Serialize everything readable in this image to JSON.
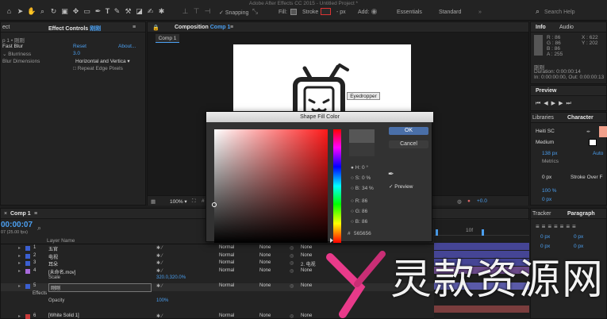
{
  "app_title": "Adobe After Effects CC 2015 - Untitled Project *",
  "toolbar": {
    "snapping": "Snapping",
    "fill": "Fill:",
    "stroke": "Stroke",
    "stroke_px": "- px",
    "add": "Add:",
    "workspaces": [
      "Essentials",
      "Standard"
    ],
    "search_placeholder": "Search Help"
  },
  "effect_controls": {
    "layer_left": "p 1 • 刚刚",
    "tab": "Effect Controls",
    "tab_layer": "刚刚",
    "fx_name": "Fast Blur",
    "reset": "Reset",
    "about": "About...",
    "blurriness_label": "Blurriness",
    "blurriness_value": "3.0",
    "blur_dimensions_label": "Blur Dimensions",
    "blur_dimensions_value": "Horizontal and Vertica",
    "repeat_edge": "Repeat Edge Pixels"
  },
  "composition": {
    "tab": "Composition",
    "tab_name": "Comp 1",
    "sub_tab": "Comp 1",
    "tooltip": "Eyedropper",
    "zoom": "100%",
    "timecode": "+0.0"
  },
  "info": {
    "tab": "Info",
    "tab2": "Audio",
    "r": "R : 86",
    "g": "G : 86",
    "b": "B : 86",
    "a": "A : 255",
    "x": "X : 622",
    "y": "Y : 202",
    "layer": "刚刚",
    "duration": "Duration: 0:00:00:14",
    "in_out": "In: 0:00:00:00, Out: 0:00:00:13"
  },
  "preview": {
    "tab": "Preview"
  },
  "libraries": {
    "tab": "Libraries"
  },
  "character": {
    "tab": "Character",
    "font": "Heiti SC",
    "style": "Medium",
    "size": "138 px",
    "auto": "Auto",
    "metrics": "Metrics",
    "indent": "0 px",
    "stroke_over": "Stroke Over F",
    "vscale": "100 %",
    "baseline": "0 px"
  },
  "tracker": {
    "tab": "Tracker",
    "tab2": "Paragraph"
  },
  "dialog": {
    "title": "Shape Fill Color",
    "ok": "OK",
    "cancel": "Cancel",
    "preview": "Preview",
    "h_label": "H:",
    "h_value": "0 °",
    "s_label": "S:",
    "s_value": "0 %",
    "b_label": "B:",
    "b_value": "34 %",
    "r_label": "R:",
    "r_value": "86",
    "g_label": "G:",
    "g_value": "86",
    "b2_label": "B:",
    "b2_value": "86",
    "hex_label": "#",
    "hex_value": "565656",
    "new_color": "#565656",
    "current_color": "#3a3a3a"
  },
  "timeline": {
    "tab": "Comp 1",
    "timecode": "00:00:07",
    "fps": "07 (25.00 fps)",
    "col_layer_name": "Layer Name",
    "layers": [
      {
        "num": "1",
        "name": "五官",
        "color": "#3b5fd1"
      },
      {
        "num": "2",
        "name": "电视",
        "color": "#3b5fd1"
      },
      {
        "num": "3",
        "name": "耳朵",
        "color": "#3b5fd1"
      },
      {
        "num": "4",
        "name": "[未命名.mov]",
        "color": "#a86adb"
      },
      {
        "num": "5",
        "name": "刚刚",
        "color": "#3b5fd1"
      },
      {
        "num": "6",
        "name": "[White Solid 1]",
        "color": "#c93b3b"
      }
    ],
    "scale_label": "Scale",
    "scale_value": "320.0,320.0%",
    "effects_label": "Effects",
    "opacity_label": "Opacity",
    "opacity_value": "100%",
    "mode": "Normal",
    "trkmat": "None",
    "parent_none": "None",
    "parent_2": "2. 电视",
    "ruler": "10f"
  },
  "watermark": {
    "text": "灵款资源网"
  },
  "colors": {
    "accent": "#4b9ff0",
    "selection": "#2a5a94"
  }
}
